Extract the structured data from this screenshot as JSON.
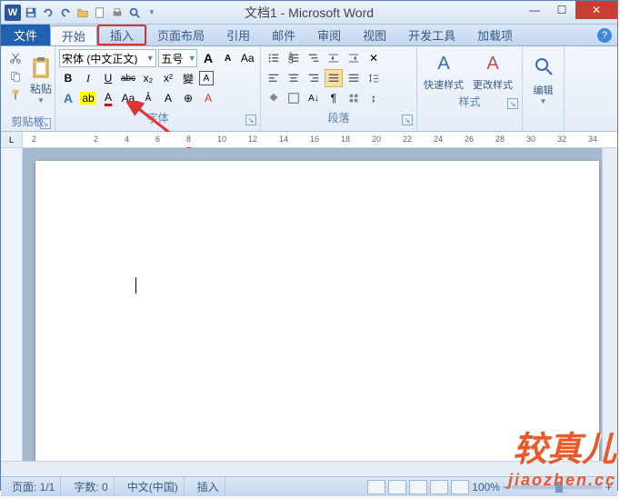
{
  "titlebar": {
    "title": "文档1 - Microsoft Word"
  },
  "winbtns": {
    "min": "—",
    "max": "☐",
    "close": "✕"
  },
  "tabs": {
    "file": "文件",
    "home": "开始",
    "insert": "插入",
    "layout": "页面布局",
    "ref": "引用",
    "mail": "邮件",
    "review": "审阅",
    "view": "视图",
    "dev": "开发工具",
    "addin": "加载项"
  },
  "clipboard": {
    "paste": "粘贴",
    "group": "剪贴板"
  },
  "font": {
    "name": "宋体 (中文正文)",
    "size": "五号",
    "grow": "A",
    "shrink": "A",
    "group": "字体",
    "bold": "B",
    "italic": "I",
    "underline": "U",
    "strike": "abc",
    "sub": "x₂",
    "sup": "x²"
  },
  "para": {
    "group": "段落"
  },
  "styles": {
    "quick": "快速样式",
    "change": "更改样式",
    "group": "样式"
  },
  "editing": {
    "label": "编辑"
  },
  "status": {
    "page": "页面: 1/1",
    "words": "字数: 0",
    "lang": "中文(中国)",
    "mode": "插入",
    "zoom": "100%"
  },
  "watermark": {
    "brand": "较真儿",
    "url": "jiaozhen.cc"
  },
  "ruler": {
    "marks": [
      "2",
      "",
      "2",
      "4",
      "6",
      "8",
      "10",
      "12",
      "14",
      "16",
      "18",
      "20",
      "22",
      "24",
      "26",
      "28",
      "30",
      "32",
      "34"
    ]
  }
}
